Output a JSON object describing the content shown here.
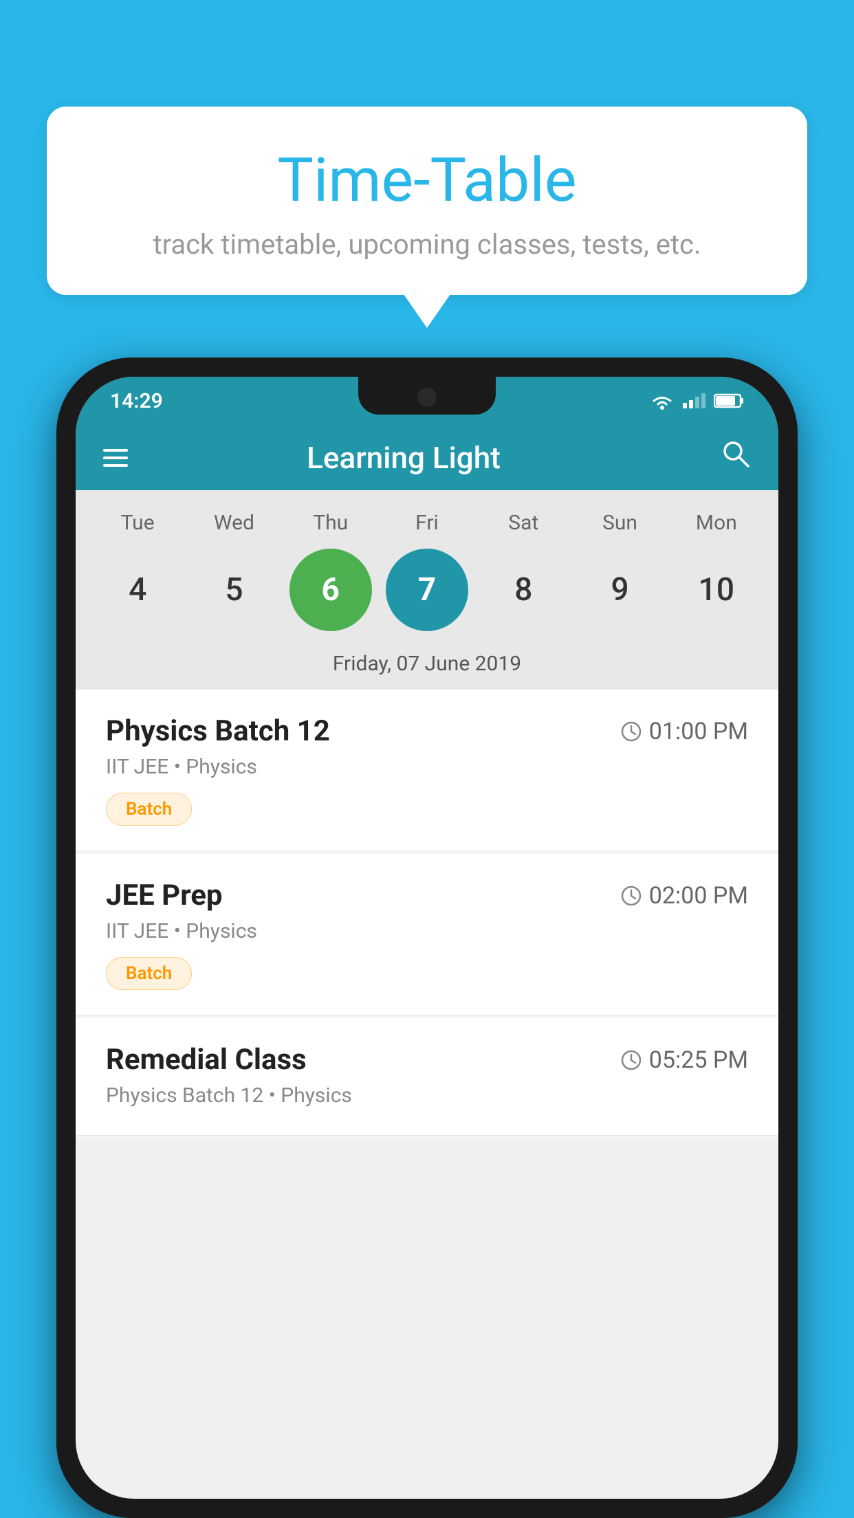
{
  "background_color": "#29b6e8",
  "tooltip": {
    "title": "Time-Table",
    "subtitle": "track timetable, upcoming classes, tests, etc."
  },
  "status_bar": {
    "time": "14:29",
    "signal_bars": [
      8,
      13,
      18,
      22
    ],
    "battery_level": "75"
  },
  "app_header": {
    "title": "Learning Light",
    "search_label": "search"
  },
  "calendar": {
    "days": [
      "Tue",
      "Wed",
      "Thu",
      "Fri",
      "Sat",
      "Sun",
      "Mon"
    ],
    "dates": [
      {
        "num": "4",
        "state": "normal"
      },
      {
        "num": "5",
        "state": "normal"
      },
      {
        "num": "6",
        "state": "today"
      },
      {
        "num": "7",
        "state": "selected"
      },
      {
        "num": "8",
        "state": "normal"
      },
      {
        "num": "9",
        "state": "normal"
      },
      {
        "num": "10",
        "state": "normal"
      }
    ],
    "selected_date_label": "Friday, 07 June 2019"
  },
  "schedule_items": [
    {
      "title": "Physics Batch 12",
      "time": "01:00 PM",
      "subtitle": "IIT JEE • Physics",
      "tag": "Batch"
    },
    {
      "title": "JEE Prep",
      "time": "02:00 PM",
      "subtitle": "IIT JEE • Physics",
      "tag": "Batch"
    },
    {
      "title": "Remedial Class",
      "time": "05:25 PM",
      "subtitle": "Physics Batch 12 • Physics",
      "tag": null
    }
  ]
}
